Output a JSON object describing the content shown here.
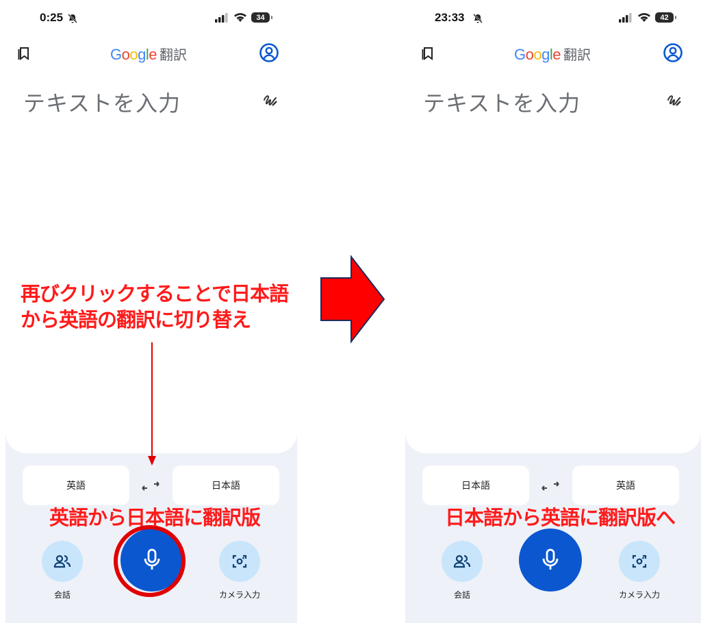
{
  "left_screen": {
    "status": {
      "time": "0:25",
      "battery": "34"
    },
    "header": {
      "logo": "Google",
      "suffix": "翻訳"
    },
    "input": {
      "placeholder": "テキストを入力"
    },
    "languages": {
      "source": "英語",
      "target": "日本語"
    },
    "actions": {
      "conversation": "会話",
      "camera": "カメラ入力"
    }
  },
  "right_screen": {
    "status": {
      "time": "23:33",
      "battery": "42"
    },
    "header": {
      "logo": "Google",
      "suffix": "翻訳"
    },
    "input": {
      "placeholder": "テキストを入力"
    },
    "languages": {
      "source": "日本語",
      "target": "英語"
    },
    "actions": {
      "conversation": "会話",
      "camera": "カメラ入力"
    }
  },
  "annotations": {
    "instruction": "再びクリックすることで日本語から英語の翻訳に切り替え",
    "left_caption": "英語から日本語に翻訳版",
    "right_caption": "日本語から英語に翻訳版へ"
  },
  "colors": {
    "annotation": "#ff1a1a",
    "mic_button": "#0b57d0",
    "panel_bg": "#eef1f8",
    "round_button": "#c9e5fb"
  },
  "icons": [
    "bell-muted-icon",
    "signal-icon",
    "wifi-icon",
    "battery-icon",
    "bookmark-icon",
    "account-icon",
    "handwrite-icon",
    "swap-icon",
    "conversation-icon",
    "mic-icon",
    "camera-icon"
  ]
}
